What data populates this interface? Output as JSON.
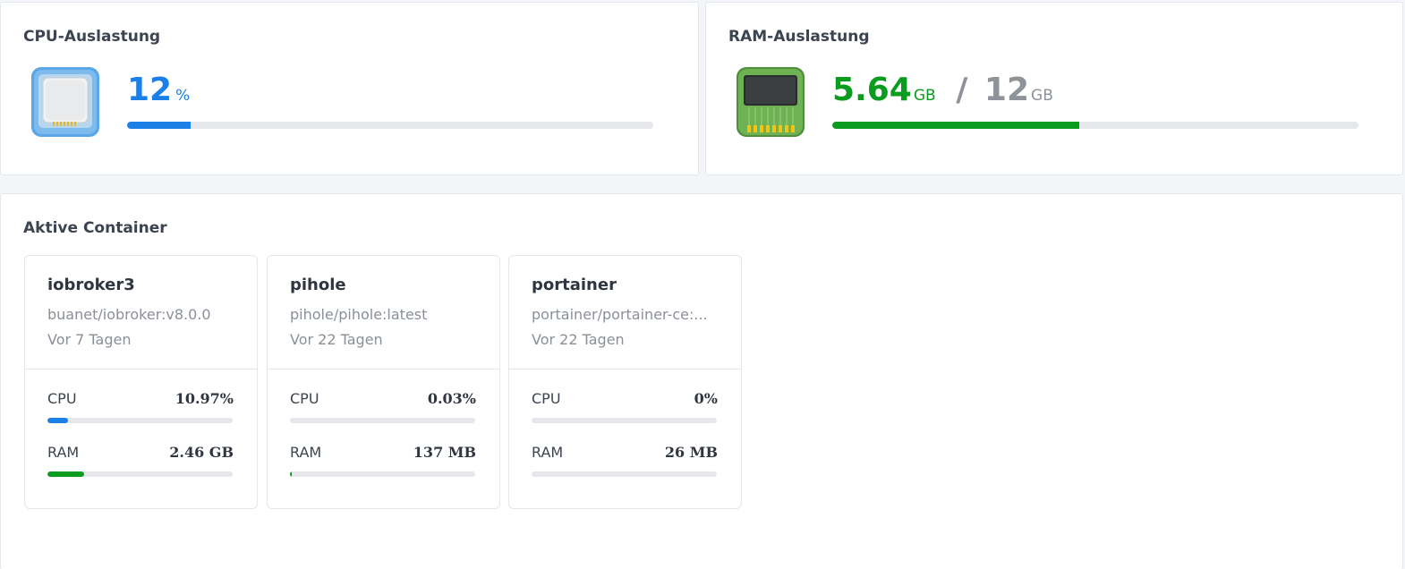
{
  "cpu": {
    "title": "CPU-Auslastung",
    "value": "12",
    "unit": "%",
    "usage_fraction": 0.12,
    "color": "#1a7fe6",
    "icon": "cpu-chip-icon"
  },
  "ram": {
    "title": "RAM-Auslastung",
    "used": "5.64",
    "used_unit": "GB",
    "separator": "/",
    "total": "12",
    "total_unit": "GB",
    "usage_fraction": 0.47,
    "color": "#0a9c1f",
    "icon": "memory-module-icon"
  },
  "containers": {
    "title": "Aktive Container",
    "cpu_label": "CPU",
    "ram_label": "RAM",
    "cpu_color": "#1a7fe6",
    "ram_color": "#0a9c1f",
    "items": [
      {
        "name": "iobroker3",
        "image": "buanet/iobroker:v8.0.0",
        "age": "Vor 7 Tagen",
        "cpu": "10.97%",
        "cpu_fraction": 0.11,
        "ram": "2.46 GB",
        "ram_fraction": 0.2
      },
      {
        "name": "pihole",
        "image": "pihole/pihole:latest",
        "age": "Vor 22 Tagen",
        "cpu": "0.03%",
        "cpu_fraction": 0.0,
        "ram": "137 MB",
        "ram_fraction": 0.011
      },
      {
        "name": "portainer",
        "image": "portainer/portainer-ce:...",
        "age": "Vor 22 Tagen",
        "cpu": "0%",
        "cpu_fraction": 0.0,
        "ram": "26 MB",
        "ram_fraction": 0.0
      }
    ]
  }
}
